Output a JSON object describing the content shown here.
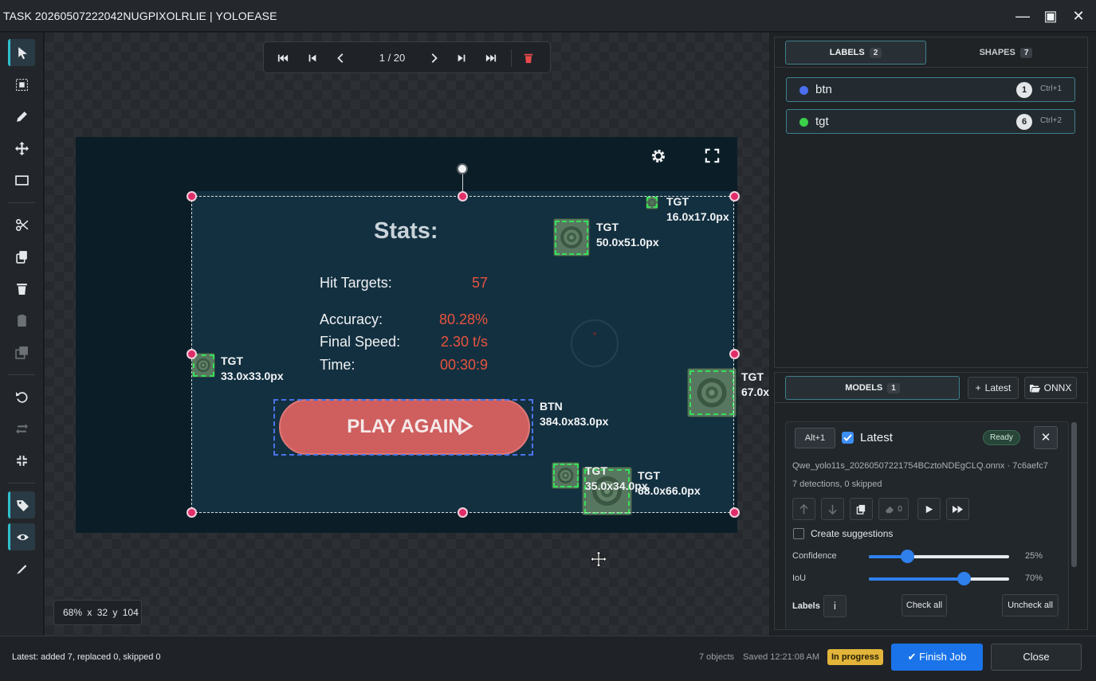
{
  "window": {
    "title": "TASK 20260507222042NUGPIXOLRLIE | YOLOEASE",
    "minimize_icon": "—",
    "maximize_icon": "▣",
    "close_icon": "✕"
  },
  "toolbar": {
    "tools": [
      "select",
      "box-select",
      "pencil",
      "move",
      "rectangle",
      "scissors",
      "copy",
      "trash",
      "clipboard",
      "duplicate",
      "undo",
      "redo",
      "collapse",
      "labels-tag",
      "visibility",
      "brush"
    ],
    "active_color": "#2fc0ce"
  },
  "navigation": {
    "page_counter": "1 / 20"
  },
  "game": {
    "title": "Stats:",
    "rows": [
      {
        "label": "Hit Targets:",
        "value": "57"
      },
      {
        "label": "Accuracy:",
        "value": "80.28%"
      },
      {
        "label": "Final Speed:",
        "value": "2.30 t/s"
      },
      {
        "label": "Time:",
        "value": "00:30:9"
      }
    ],
    "play_again": "PLAY AGAIN"
  },
  "annotations": {
    "labels": [
      {
        "id": "tgt1",
        "class": "TGT",
        "size": "16.0x17.0px"
      },
      {
        "id": "tgt2",
        "class": "TGT",
        "size": "50.0x51.0px"
      },
      {
        "id": "tgt3",
        "class": "TGT",
        "size": "33.0x33.0px"
      },
      {
        "id": "tgt4",
        "class": "TGT",
        "size": "67.0x"
      },
      {
        "id": "btn1",
        "class": "BTN",
        "size": "384.0x83.0px"
      },
      {
        "id": "tgt5",
        "class": "TGT",
        "size": "35.0x34.0px"
      },
      {
        "id": "tgt6",
        "class": "TGT",
        "size": "68.0x66.0px"
      }
    ],
    "colors": {
      "tgt": "#36e05a",
      "btn": "#4b74e8",
      "handle": "#e02d6a"
    }
  },
  "canvas_info": {
    "zoom": "68%",
    "x": "x 32",
    "y": "y 104"
  },
  "labels_panel": {
    "tabs": [
      {
        "label": "LABELS",
        "count": "2"
      },
      {
        "label": "SHAPES",
        "count": "7"
      }
    ],
    "items": [
      {
        "name": "btn",
        "count": "1",
        "shortcut": "Ctrl+1",
        "color": "#4b6ef0"
      },
      {
        "name": "tgt",
        "count": "6",
        "shortcut": "Ctrl+2",
        "color": "#3bd14a"
      }
    ]
  },
  "models_panel": {
    "tab_label": "MODELS",
    "tab_count": "1",
    "add_latest": "Latest",
    "onnx": "ONNX",
    "model": {
      "shortcut": "Alt+1",
      "name": "Latest",
      "status": "Ready",
      "file": "Qwe_yolo11s_20260507221754BCztoNDEgCLQ.onnx · 7c6aefc7",
      "stats": "7 detections, 0 skipped",
      "erase_count": "0",
      "create_suggestions": "Create suggestions",
      "confidence_label": "Confidence",
      "confidence_value": "25%",
      "confidence": 0.25,
      "iou_label": "IoU",
      "iou_value": "70%",
      "iou": 0.7,
      "labels_label": "Labels",
      "info": "i",
      "check_all": "Check all",
      "uncheck_all": "Uncheck all"
    }
  },
  "status_bar": {
    "message": "Latest: added 7, replaced 0, skipped 0",
    "objects": "7 objects",
    "saved": "Saved 12:21:08 AM",
    "state": "In progress",
    "finish": "Finish Job",
    "close": "Close"
  }
}
